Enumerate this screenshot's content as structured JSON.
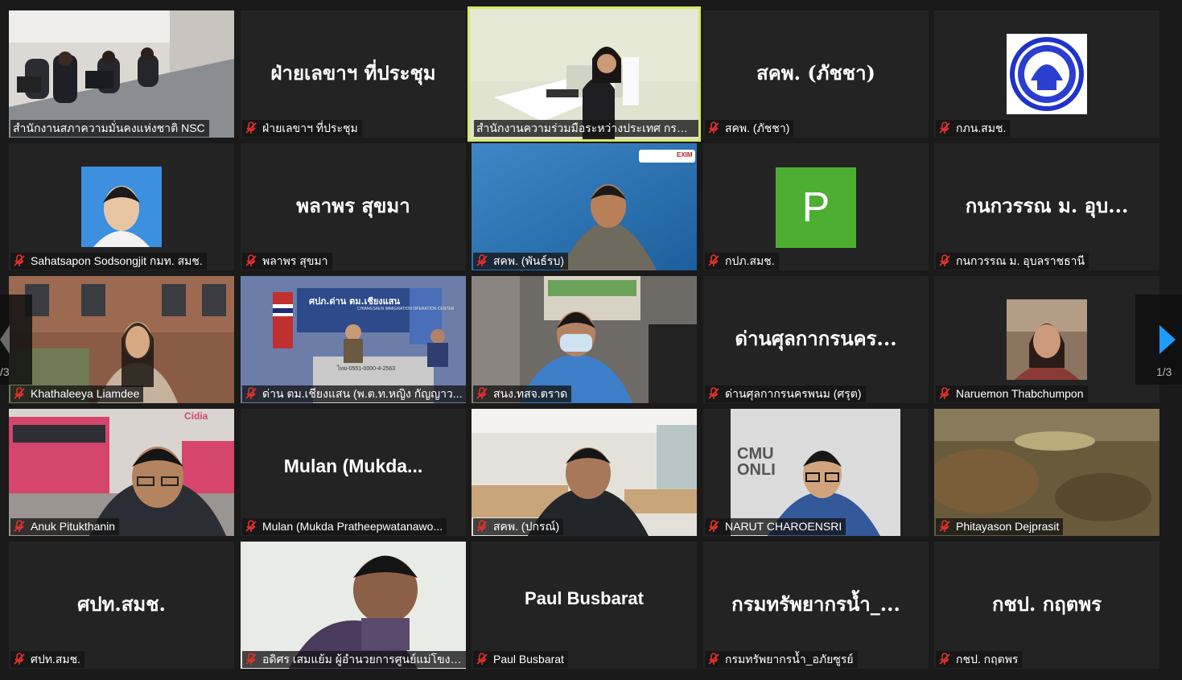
{
  "colors": {
    "active_speaker_border": "#d8e866",
    "tile_bg": "#232323",
    "page_bg": "#1a1a1a",
    "nav_arrow": "#1e9bff",
    "muted_icon": "#e0312b"
  },
  "pagination": {
    "right_label": "1/3",
    "left_label": "/3"
  },
  "tiles": [
    {
      "big": "",
      "label": "สำนักงานสภาความมั่นคงแห่งชาติ NSC",
      "muted": false
    },
    {
      "big": "ฝ่ายเลขาฯ ที่ประชุม",
      "label": "ฝ่ายเลขาฯ ที่ประชุม",
      "muted": true
    },
    {
      "big": "",
      "label": "สำนักงานความร่วมมือระหว่างประเทศ กรมควบคุม...",
      "muted": false
    },
    {
      "big": "สคพ. (ภัชชา)",
      "label": "สคพ. (ภัชชา)",
      "muted": true
    },
    {
      "big": "",
      "label": "กภน.สมช.",
      "muted": true
    },
    {
      "big": "",
      "label": "Sahatsapon Sodsongjit กมท. สมช.",
      "muted": true
    },
    {
      "big": "พลาพร สุขมา",
      "label": "พลาพร สุขมา",
      "muted": true
    },
    {
      "big": "",
      "label": "สคพ. (พันธ์รบ)",
      "muted": true
    },
    {
      "big": "",
      "label": "กปภ.สมช.",
      "muted": true
    },
    {
      "big": "กนกวรรณ ม. อุบ...",
      "label": "กนกวรรณ ม. อุบลราชธานี",
      "muted": true
    },
    {
      "big": "",
      "label": "Khathaleeya Liamdee",
      "muted": true
    },
    {
      "big": "",
      "label": "ด่าน ตม.เชียงแสน (พ.ต.ท.หญิง กัญญาว...",
      "muted": true
    },
    {
      "big": "",
      "label": "สนง.ทสจ.ตราด",
      "muted": true
    },
    {
      "big": "ด่านศุลกากรนคร...",
      "label": "ด่านศุลกากรนครพนม (ศรุต)",
      "muted": true
    },
    {
      "big": "",
      "label": "Naruemon Thabchumpon",
      "muted": true
    },
    {
      "big": "",
      "label": "Anuk Pitukthanin",
      "muted": true
    },
    {
      "big": "Mulan (Mukda...",
      "label": "Mulan (Mukda Pratheepwatanawo...",
      "muted": true
    },
    {
      "big": "",
      "label": "สคพ. (ปกรณ์)",
      "muted": true
    },
    {
      "big": "",
      "label": "NARUT CHAROENSRI",
      "muted": true
    },
    {
      "big": "",
      "label": "Phitayason Dejprasit",
      "muted": true
    },
    {
      "big": "ศปท.สมช.",
      "label": "ศปท.สมช.",
      "muted": true
    },
    {
      "big": "",
      "label": "อดิศร เสมแย้ม ผู้อำนวยการศูนย์แม่โขงศึ...",
      "muted": true
    },
    {
      "big": "Paul Busbarat",
      "label": "Paul Busbarat",
      "muted": true
    },
    {
      "big": "กรมทรัพยากรน้ำ_...",
      "label": "กรมทรัพยากรน้ำ_อภัยซูรย์",
      "muted": true
    },
    {
      "big": "กชป. กฤตพร",
      "label": "กชป. กฤตพร",
      "muted": true
    }
  ],
  "avatar_letter": "P",
  "cmu_sign": "CMU ONLI",
  "banner_sign": "ศปภ.ด่าน ตม.เชียงแสน",
  "banner_sub": "CHIANGSAEN IMMIGRATION OPERATION CENTER",
  "plate": "ไทย-0551-0000-4-2563",
  "logo_brand": "Cidia",
  "exim_logo": "EXIM"
}
